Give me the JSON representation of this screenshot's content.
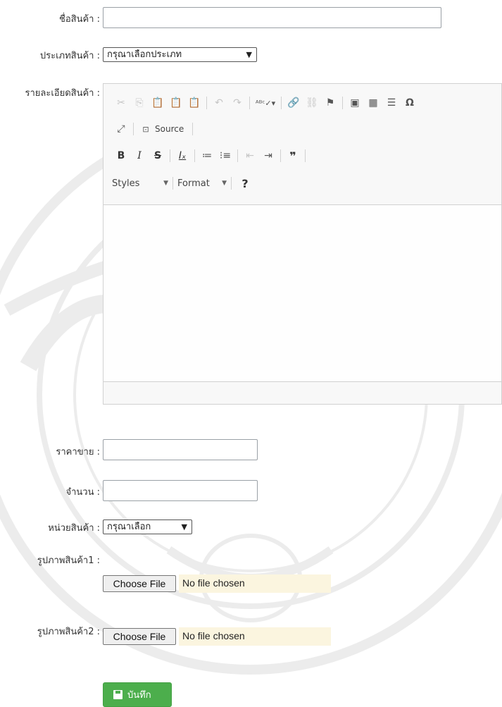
{
  "form": {
    "name_label": "ชื่อสินค้า :",
    "name_value": "",
    "category_label": "ประเภทสินค้า :",
    "category_selected": "กรุณาเลือกประเภท",
    "detail_label": "รายละเอียดสินค้า :",
    "price_label": "ราคาขาย :",
    "price_value": "",
    "quantity_label": "จำนวน :",
    "quantity_value": "",
    "unit_label": "หน่วยสินค้า :",
    "unit_selected": "กรุณาเลือก",
    "image1_label": "รูปภาพสินค้า1 :",
    "image2_label": "รูปภาพสินค้า2 :",
    "choose_file_label": "Choose File",
    "no_file_text": "No file chosen",
    "save_label": "บันทึก"
  },
  "editor": {
    "source_label": "Source",
    "styles_label": "Styles",
    "format_label": "Format",
    "help_label": "?",
    "icons": [
      "cut-icon",
      "copy-icon",
      "paste-icon",
      "paste-text-icon",
      "paste-word-icon",
      "undo-icon",
      "redo-icon",
      "spellcheck-icon",
      "link-icon",
      "unlink-icon",
      "anchor-icon",
      "image-icon",
      "table-icon",
      "horizontal-line-icon",
      "special-char-icon",
      "maximize-icon",
      "source-icon",
      "bold-icon",
      "italic-icon",
      "strike-icon",
      "remove-format-icon",
      "numbered-list-icon",
      "bulleted-list-icon",
      "outdent-icon",
      "indent-icon",
      "blockquote-icon"
    ]
  },
  "colors": {
    "save_button": "#4cae4c",
    "file_name_bg": "#fbf5df",
    "editor_border": "#d1d1d1"
  }
}
